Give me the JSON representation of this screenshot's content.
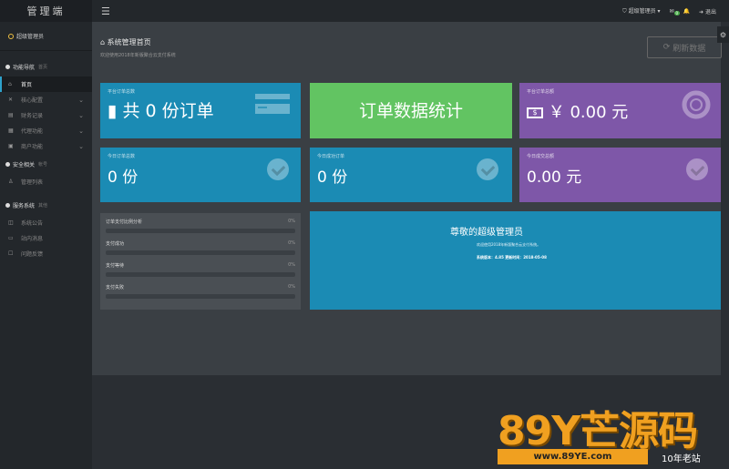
{
  "sidebar": {
    "brand": "管理端",
    "user": "超级管理员",
    "sections": [
      {
        "title": "功能导航",
        "sub": "首页"
      },
      {
        "title": "安全相关",
        "sub": "帐号"
      },
      {
        "title": "服务系统",
        "sub": "其他"
      }
    ],
    "nav_items": [
      {
        "label": "首页",
        "icon": "home-icon"
      },
      {
        "label": "核心配置",
        "icon": "config-icon"
      },
      {
        "label": "财务记录",
        "icon": "finance-icon"
      },
      {
        "label": "代理功能",
        "icon": "agent-icon"
      },
      {
        "label": "商户功能",
        "icon": "merchant-icon"
      }
    ],
    "security_items": [
      {
        "label": "管理列表",
        "icon": "user-icon"
      }
    ],
    "service_items": [
      {
        "label": "系统公告",
        "icon": "notice-icon"
      },
      {
        "label": "站内消息",
        "icon": "message-icon"
      },
      {
        "label": "问题反馈",
        "icon": "feedback-icon"
      }
    ]
  },
  "topbar": {
    "user_label": "超级管理员",
    "message_count": "0",
    "logout_label": "退出"
  },
  "header": {
    "title": "系统管理首页",
    "subtitle": "欢迎使用2018年新版聚合云支付系统",
    "refresh_label": "刷新数据"
  },
  "cards": {
    "total_orders": {
      "label": "平台订单总数",
      "value": "共 0 份订单"
    },
    "order_stats": {
      "label": "订单数据统计"
    },
    "platform_amount": {
      "label": "平台订单总额",
      "value": "￥ 0.00 元"
    },
    "today_orders": {
      "label": "今日订单总数",
      "value": "0 份"
    },
    "today_success": {
      "label": "今日成功订单",
      "value": "0 份"
    },
    "today_amount": {
      "label": "今日成交总额",
      "value": "0.00 元"
    }
  },
  "progress": [
    {
      "label": "订单支付比例分析",
      "pct": "0%",
      "value": 0
    },
    {
      "label": "支付成功",
      "pct": "0%",
      "value": 0
    },
    {
      "label": "支付等待",
      "pct": "0%",
      "value": 0
    },
    {
      "label": "支付失败",
      "pct": "0%",
      "value": 0
    }
  ],
  "admin": {
    "title": "尊敬的超级管理员",
    "welcome": "欢迎使用2018年新版聚合云支付系统。",
    "info": "系统版本：4.85 更新时间：2018-05-08"
  },
  "watermark": {
    "brand": "89Y芒源码",
    "url": "www.89YE.com",
    "tag": "10年老站"
  },
  "colors": {
    "blue": "#1b8bb4",
    "green": "#62c462",
    "purple": "#7e57a8",
    "sidebar": "#23272b",
    "content": "#3a3f44"
  }
}
